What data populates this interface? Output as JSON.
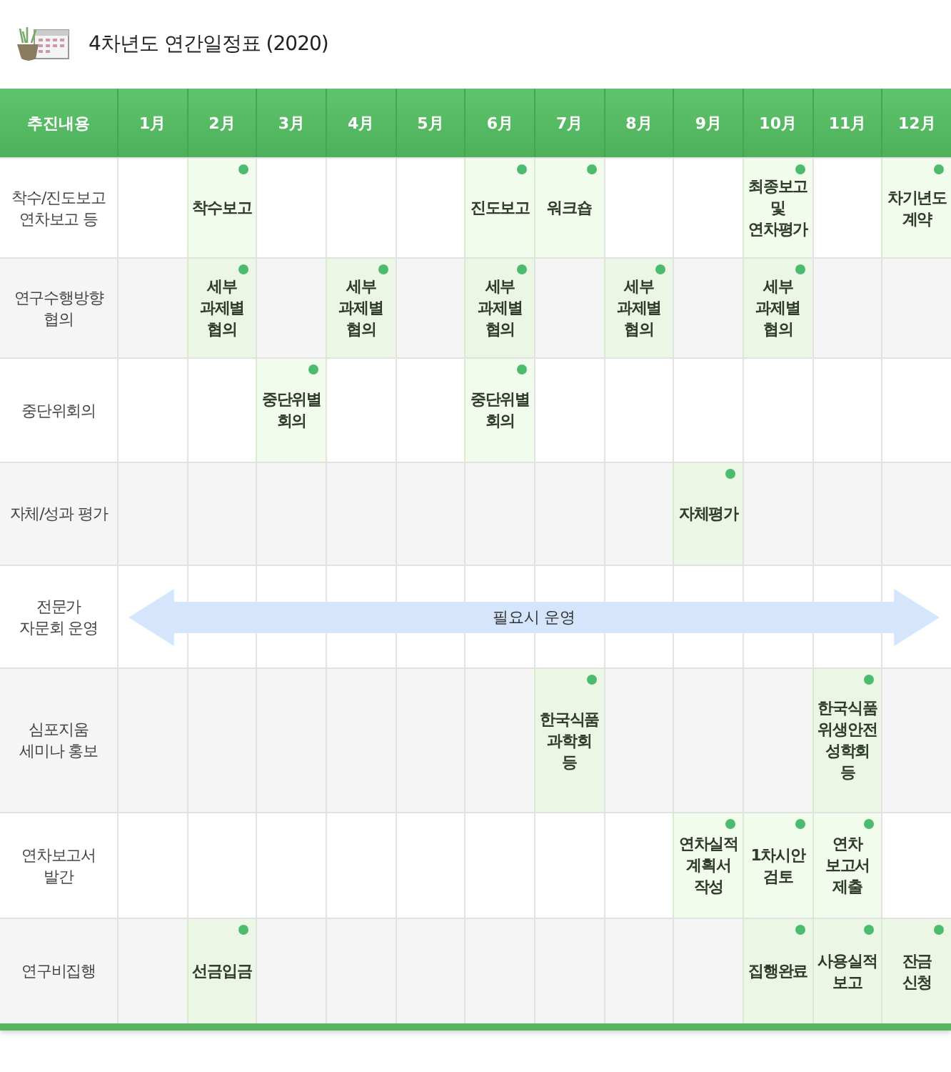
{
  "title": "4차년도 연간일정표 (2020)",
  "header": {
    "label": "추진내용",
    "months": [
      "1月",
      "2月",
      "3月",
      "4月",
      "5月",
      "6月",
      "7月",
      "8月",
      "9月",
      "10月",
      "11月",
      "12月"
    ]
  },
  "rows": [
    {
      "label": "착수/진도보고\n연차보고 등",
      "kind": "cells",
      "cells": [
        {
          "kind": "empty"
        },
        {
          "kind": "event",
          "text": "착수보고"
        },
        {
          "kind": "empty"
        },
        {
          "kind": "empty"
        },
        {
          "kind": "empty"
        },
        {
          "kind": "event",
          "text": "진도보고"
        },
        {
          "kind": "event",
          "text": "워크숍"
        },
        {
          "kind": "empty"
        },
        {
          "kind": "empty"
        },
        {
          "kind": "event",
          "text": "최종보고\n및\n연차평가"
        },
        {
          "kind": "empty"
        },
        {
          "kind": "event",
          "text": "차기년도\n계약"
        }
      ]
    },
    {
      "label": "연구수행방향\n협의",
      "kind": "cells",
      "cells": [
        {
          "kind": "empty"
        },
        {
          "kind": "event",
          "text": "세부\n과제별\n협의"
        },
        {
          "kind": "empty"
        },
        {
          "kind": "event",
          "text": "세부\n과제별\n협의"
        },
        {
          "kind": "empty"
        },
        {
          "kind": "event",
          "text": "세부\n과제별\n협의"
        },
        {
          "kind": "empty"
        },
        {
          "kind": "event",
          "text": "세부\n과제별\n협의"
        },
        {
          "kind": "empty"
        },
        {
          "kind": "event",
          "text": "세부\n과제별\n협의"
        },
        {
          "kind": "empty"
        },
        {
          "kind": "empty"
        }
      ]
    },
    {
      "label": "중단위회의",
      "kind": "cells",
      "cells": [
        {
          "kind": "empty"
        },
        {
          "kind": "empty"
        },
        {
          "kind": "event",
          "text": "중단위별\n회의"
        },
        {
          "kind": "empty"
        },
        {
          "kind": "empty"
        },
        {
          "kind": "event",
          "text": "중단위별\n회의"
        },
        {
          "kind": "empty"
        },
        {
          "kind": "empty"
        },
        {
          "kind": "empty"
        },
        {
          "kind": "empty"
        },
        {
          "kind": "empty"
        },
        {
          "kind": "empty"
        }
      ]
    },
    {
      "label": "자체/성과 평가",
      "kind": "cells",
      "cells": [
        {
          "kind": "empty"
        },
        {
          "kind": "empty"
        },
        {
          "kind": "empty"
        },
        {
          "kind": "empty"
        },
        {
          "kind": "empty"
        },
        {
          "kind": "empty"
        },
        {
          "kind": "empty"
        },
        {
          "kind": "empty"
        },
        {
          "kind": "event",
          "text": "자체평가"
        },
        {
          "kind": "empty"
        },
        {
          "kind": "empty"
        },
        {
          "kind": "empty"
        }
      ]
    },
    {
      "label": "전문가\n자문회 운영",
      "kind": "span",
      "span_text": "필요시 운영"
    },
    {
      "label": "심포지움\n세미나 홍보",
      "kind": "cells",
      "cells": [
        {
          "kind": "empty"
        },
        {
          "kind": "empty"
        },
        {
          "kind": "empty"
        },
        {
          "kind": "empty"
        },
        {
          "kind": "empty"
        },
        {
          "kind": "empty"
        },
        {
          "kind": "event",
          "text": "한국식품\n과학회\n등"
        },
        {
          "kind": "empty"
        },
        {
          "kind": "empty"
        },
        {
          "kind": "empty"
        },
        {
          "kind": "event",
          "text": "한국식품\n위생안전\n성학회\n등"
        },
        {
          "kind": "empty"
        }
      ]
    },
    {
      "label": "연차보고서\n발간",
      "kind": "cells",
      "cells": [
        {
          "kind": "empty"
        },
        {
          "kind": "empty"
        },
        {
          "kind": "empty"
        },
        {
          "kind": "empty"
        },
        {
          "kind": "empty"
        },
        {
          "kind": "empty"
        },
        {
          "kind": "empty"
        },
        {
          "kind": "empty"
        },
        {
          "kind": "event",
          "text": "연차실적\n계획서\n작성"
        },
        {
          "kind": "event",
          "text": "1차시안\n검토"
        },
        {
          "kind": "event",
          "text": "연차\n보고서\n제출"
        },
        {
          "kind": "empty"
        }
      ]
    },
    {
      "label": "연구비집행",
      "kind": "cells",
      "cells": [
        {
          "kind": "empty"
        },
        {
          "kind": "event",
          "text": "선금입금"
        },
        {
          "kind": "empty"
        },
        {
          "kind": "empty"
        },
        {
          "kind": "empty"
        },
        {
          "kind": "empty"
        },
        {
          "kind": "empty"
        },
        {
          "kind": "empty"
        },
        {
          "kind": "empty"
        },
        {
          "kind": "event",
          "text": "집행완료"
        },
        {
          "kind": "event",
          "text": "사용실적\n보고"
        },
        {
          "kind": "event",
          "text": "잔금\n신청"
        }
      ]
    }
  ]
}
